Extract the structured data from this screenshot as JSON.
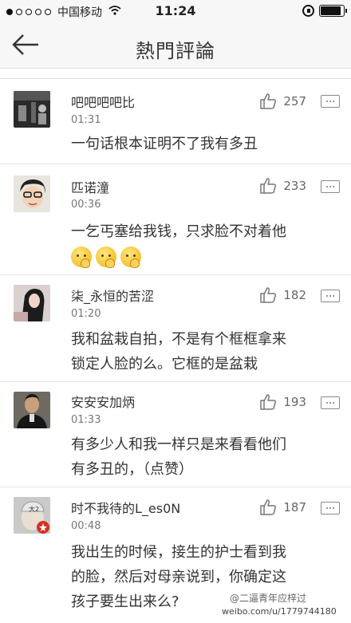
{
  "status_bar": {
    "carrier": "中国移动",
    "time": "11:24",
    "signal_icon": "signal-dots-icon",
    "wifi_icon": "wifi-icon",
    "lock_icon": "rotation-lock-icon",
    "battery_icon": "battery-icon"
  },
  "nav": {
    "title": "熱門評論",
    "back_icon": "arrow-left-icon"
  },
  "comments": [
    {
      "username": "吧吧吧吧比",
      "time": "01:31",
      "likes": "257",
      "text": [
        "一句话根本证明不了我有多丑"
      ]
    },
    {
      "username": "匹诺潼",
      "time": "00:36",
      "likes": "233",
      "text": [
        "一乞丐塞给我钱，只求脸不对着他"
      ],
      "emojis": [
        "thinking-face-icon",
        "thinking-face-icon",
        "thinking-face-icon"
      ]
    },
    {
      "username": "柒_永恒的苦涩",
      "time": "01:20",
      "likes": "182",
      "text": [
        "我和盆栽自拍，不是有个框框拿来",
        "锁定人脸的么。它框的是盆栽"
      ]
    },
    {
      "username": "安安安加炳",
      "time": "01:33",
      "likes": "193",
      "text": [
        "有多少人和我一样只是来看看他们",
        "有多丑的，（点赞）"
      ]
    },
    {
      "username": "时不我待的L_es0N",
      "time": "00:48",
      "likes": "187",
      "text": [
        "我出生的时候，接生的护士看到我",
        "的脸，然后对母亲说到，你确定这",
        "孩子要生出来么?"
      ]
    }
  ],
  "watermark": {
    "line1": "@二逼青年应梓过",
    "line2": "weibo.com/u/1779744180"
  },
  "colors": {
    "background": "#ffffff",
    "bar": "#f7f7f7",
    "text": "#333333",
    "muted": "#777777"
  }
}
